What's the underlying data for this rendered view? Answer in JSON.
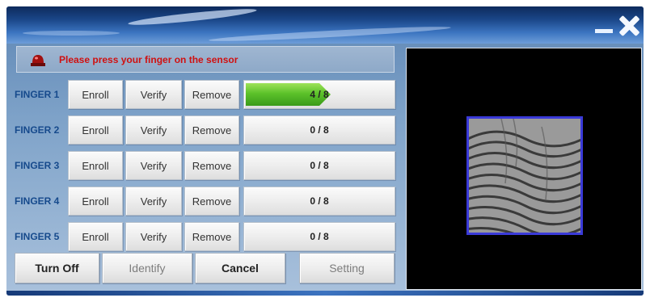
{
  "window": {
    "close_icon": "close-icon",
    "minimize_icon": "minimize-icon"
  },
  "status": {
    "icon": "alarm-light-icon",
    "text": "Please press your finger on the sensor",
    "text_color": "#d01010"
  },
  "fingers": [
    {
      "label": "FINGER 1",
      "enroll": "Enroll",
      "verify": "Verify",
      "remove": "Remove",
      "progress_text": "4 / 8",
      "progress": 0.5
    },
    {
      "label": "FINGER 2",
      "enroll": "Enroll",
      "verify": "Verify",
      "remove": "Remove",
      "progress_text": "0 / 8",
      "progress": 0
    },
    {
      "label": "FINGER 3",
      "enroll": "Enroll",
      "verify": "Verify",
      "remove": "Remove",
      "progress_text": "0 / 8",
      "progress": 0
    },
    {
      "label": "FINGER 4",
      "enroll": "Enroll",
      "verify": "Verify",
      "remove": "Remove",
      "progress_text": "0 / 8",
      "progress": 0
    },
    {
      "label": "FINGER 5",
      "enroll": "Enroll",
      "verify": "Verify",
      "remove": "Remove",
      "progress_text": "0 / 8",
      "progress": 0
    }
  ],
  "actions": {
    "turn_off": "Turn Off",
    "identify": "Identify",
    "cancel": "Cancel",
    "setting": "Setting"
  },
  "colors": {
    "progress_fill": "#5cc22a",
    "finger_label": "#164a8c",
    "preview_bg": "#000000",
    "preview_border": "#3a3ad8"
  }
}
